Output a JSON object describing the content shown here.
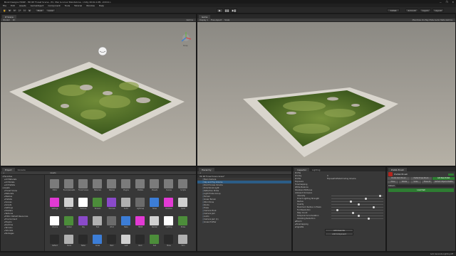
{
  "window": {
    "title": "Book Designs HDRP - HD RP Forest Scene - PC, Mac & Linux Standalone - Unity 2019.4.9f1 <DX11>",
    "controls": [
      "—",
      "❐",
      "✕"
    ]
  },
  "menu": [
    "File",
    "Edit",
    "Assets",
    "GameObject",
    "Component",
    "Tools",
    "Tutorial",
    "Window",
    "Help"
  ],
  "toolbar": {
    "tools": [
      "✋",
      "✥",
      "⟳",
      "⤢",
      "▭",
      "⊕"
    ],
    "pivot": "Pivot",
    "space": "Local",
    "play": "▶",
    "pause": "❚❚",
    "step": "▶❚",
    "collab": "Collab",
    "account": "Account",
    "layers": "Layers",
    "layout": "Layout"
  },
  "scene": {
    "tabs": [
      "# Scene"
    ],
    "shading": "Shaded",
    "mode": "2D",
    "gizmos": "Gizmos",
    "persp": "Persp"
  },
  "game": {
    "tabs": [
      "Game"
    ],
    "display": "Display 1",
    "aspect": "Free Aspect",
    "scale_label": "Scale",
    "right": "Maximize On Play  Mute Audio  Stats  Gizmos"
  },
  "project": {
    "tabs": [
      "Project",
      "Console"
    ],
    "create": "+",
    "tree": [
      "Favorites",
      "All Materials",
      "All Models",
      "All Prefabs",
      "Assets",
      "Forest Scene",
      "Materials",
      "Meshes",
      "Prefabs",
      "Scenes",
      "Scripts",
      "Settings",
      "Shaders",
      "Textures",
      "Editor Default Resources",
      "Environment",
      "Plugins",
      "Runtime",
      "Terrains",
      "Tutorials",
      "Packages"
    ],
    "breadcrumb": "Assets",
    "assets": [
      "Editor",
      "ExampleAssets",
      "Forest Scene",
      "Materials",
      "Meshes",
      "Plugins",
      "Prefabs",
      "Presets",
      "Scenes",
      "Scripts",
      "Settings",
      "Shaders",
      "Textures",
      "Terrains",
      "Tutorials",
      "Audio",
      "Lightmap",
      "Noise",
      "Particles",
      "Splat",
      "Volume",
      "Global",
      "Sky",
      "Post",
      "Wind",
      "Bake",
      "HDRP",
      "Render",
      "Lighting",
      "Probe",
      "Reflect",
      "Decal",
      "Water",
      "Grass",
      "Bark",
      "Leaf",
      "Rock",
      "Soil",
      "Moss",
      "Fern"
    ]
  },
  "hierarchy": {
    "tabs": [
      "Hierarchy"
    ],
    "scene": "HD RP Forest Scene Grass*",
    "items": [
      "Main Camera",
      "Sky and Fog Volume",
      "Post Process Volume",
      "Directional Light",
      "Reflection Probe",
      "Light Probe Group",
      "Terrain",
      "Grass Terrain",
      "Wind Zone",
      "Rocks",
      "Trees",
      "Camera Pivot",
      "Camera Jam",
      "Audio",
      "Camera Jam (1)",
      "Grass Profiler"
    ]
  },
  "inspector": {
    "tabs": [
      "Inspector",
      "Lighting"
    ],
    "fields": [
      {
        "label": "Profile",
        "value": ""
      },
      {
        "label": "Priority",
        "value": "0"
      },
      {
        "label": "Profile",
        "value": "ExposeProfileSchinding Volume"
      },
      {
        "label": "Exposure",
        "value": ""
      },
      {
        "label": "Tonemapping",
        "value": ""
      },
      {
        "label": "White Balance",
        "value": ""
      },
      {
        "label": "Shadows Midtones",
        "value": ""
      },
      {
        "label": "Ambient Occlusion",
        "value": ""
      }
    ],
    "sliders": [
      {
        "label": "Intensity",
        "value": 0.92
      },
      {
        "label": "Direct Lighting Strength",
        "value": 0.64
      },
      {
        "label": "Radius",
        "value": 0.35
      },
      {
        "label": "Quality",
        "value": 0.5
      },
      {
        "label": "Maximum Radius in Pixels",
        "value": 0.8
      },
      {
        "label": "Full Resolution",
        "value": 0.1
      },
      {
        "label": "Step Count",
        "value": 0.4
      },
      {
        "label": "Temporal Accumulation",
        "value": 0.5
      },
      {
        "label": "Ghosting Reduction",
        "value": 0.7
      }
    ],
    "sections": [
      "Bloom",
      "Tonemapping",
      "Vignette"
    ],
    "quality_value": "Medium",
    "add_override": "Add Override",
    "add_component": "Add Component"
  },
  "prefab_brush": {
    "tabs": [
      "Prefab Brush"
    ],
    "title": "Prefab Brush",
    "row1": [
      "Prefab Paint Brush",
      "Prefab Erase Brush",
      "Add New Prefab"
    ],
    "row2": [
      "Move",
      "Rotate",
      "Scale",
      "Erase All",
      "Refresh Objects Palette"
    ],
    "label": "Default",
    "load": "Load Set"
  },
  "status": {
    "text": "Auto Generate Lighting Off"
  },
  "colors": {
    "accent": "#2c5d87",
    "grass_dark": "#3d5a1e",
    "grass_light": "#6f8a37",
    "plane": "#d9d5cd",
    "green_btn": "#2e7d32",
    "red_btn": "#b3261e"
  }
}
